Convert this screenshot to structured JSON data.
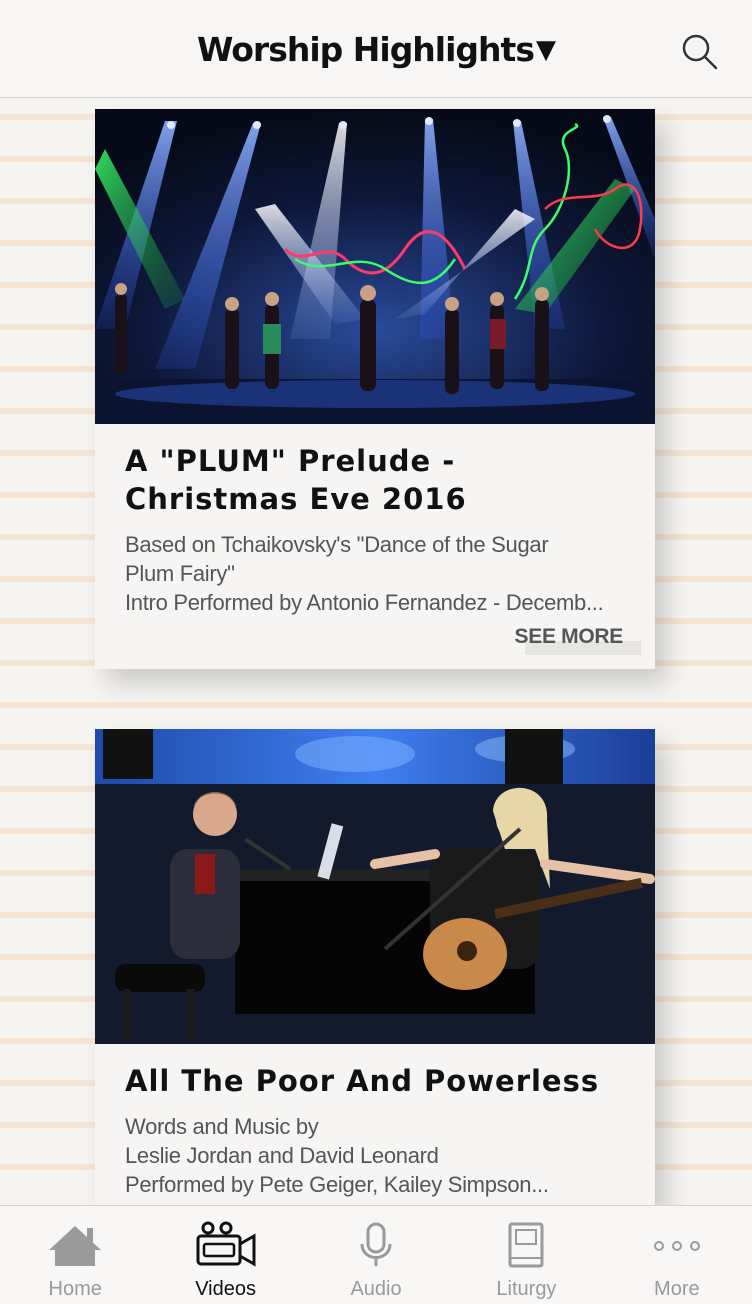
{
  "header": {
    "title": "Worship Highlights",
    "caret": "▼",
    "search_icon": "search-icon"
  },
  "cards": [
    {
      "title_lines": [
        "A \"PLUM\" Prelude -",
        "Christmas Eve 2016"
      ],
      "desc_lines": [
        "Based on Tchaikovsky's \"Dance of the Sugar",
        "Plum Fairy\"",
        "Intro Performed by Antonio Fernandez - Decemb..."
      ],
      "see_more": "SEE MORE"
    },
    {
      "title_lines": [
        "All The Poor And Powerless"
      ],
      "desc_lines": [
        "Words and Music by",
        "Leslie Jordan and David Leonard",
        "Performed by Pete Geiger, Kailey Simpson..."
      ]
    }
  ],
  "tabbar": {
    "tabs": [
      {
        "label": "Home",
        "icon": "home-icon",
        "active": false
      },
      {
        "label": "Videos",
        "icon": "video-camera-icon",
        "active": true
      },
      {
        "label": "Audio",
        "icon": "microphone-icon",
        "active": false
      },
      {
        "label": "Liturgy",
        "icon": "book-icon",
        "active": false
      },
      {
        "label": "More",
        "icon": "more-dots-icon",
        "active": false
      }
    ]
  },
  "colors": {
    "background": "#f7f5f2",
    "stripe": "#f6c8a0",
    "text_primary": "#111111",
    "text_secondary": "#555555",
    "tab_inactive": "#9a9a9a"
  }
}
